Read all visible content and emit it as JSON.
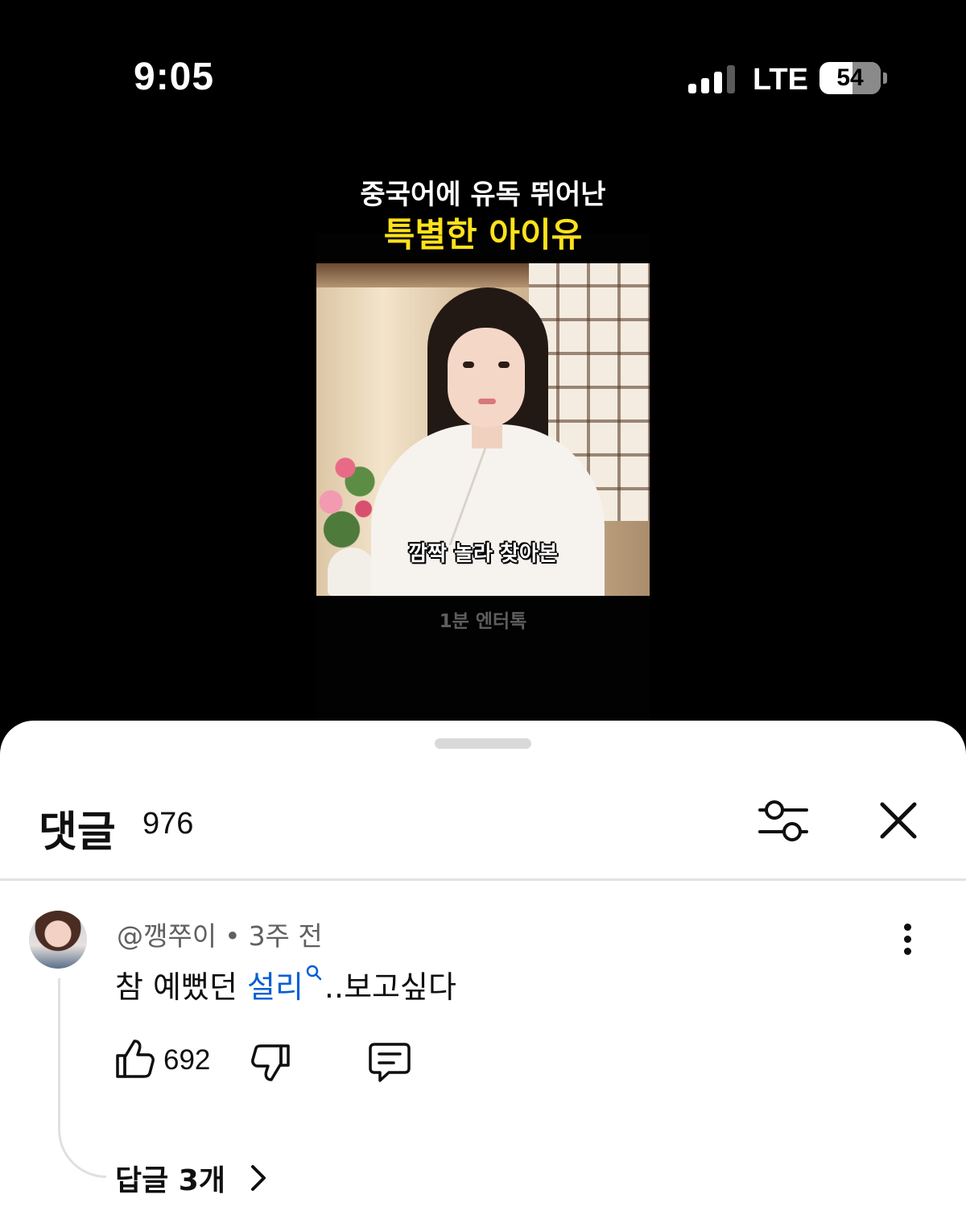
{
  "status_bar": {
    "time": "9:05",
    "network": "LTE",
    "battery": "54",
    "battery_level_percent": 54,
    "signal_bars_active": 3,
    "signal_bars_total": 4
  },
  "video": {
    "title_line_1": "중국어에 유독 뛰어난",
    "title_line_2": "특별한 아이유",
    "caption": "깜짝 놀라 찾아본",
    "channel_watermark": "1분 엔터톡",
    "title_highlight_color": "#ffe21a"
  },
  "comments": {
    "title": "댓글",
    "count": "976",
    "filter_icon": "sliders-icon",
    "close_icon": "close-icon",
    "items": [
      {
        "author": "@깽쭈이",
        "separator": "•",
        "time": "3주 전",
        "text_before": "참 예뻤던 ",
        "link_text": "설리",
        "text_after": "..보고싶다",
        "likes": "692",
        "replies_label": "답글 3개"
      }
    ],
    "link_color": "#065fd4"
  }
}
